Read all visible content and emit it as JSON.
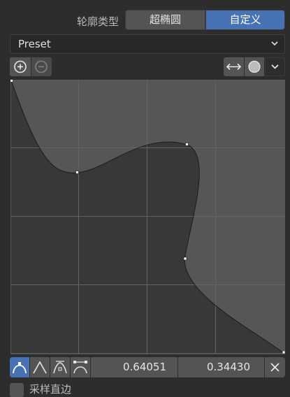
{
  "profile_type": {
    "label": "轮廓类型",
    "options": [
      "超椭圆",
      "自定义"
    ],
    "selected": "自定义"
  },
  "preset": {
    "label": "Preset"
  },
  "toolbar": {
    "zoom_in_icon": "zoom-in-icon",
    "zoom_out_icon": "zoom-out-icon",
    "flip_icon": "horizontal-arrows-icon",
    "reset_icon": "circle-dot-icon",
    "menu_icon": "chevron-down-icon"
  },
  "handles": {
    "selected_x": "0.64051",
    "selected_y": "0.34430"
  },
  "checkbox": {
    "label": "采样直边"
  },
  "colors": {
    "accent": "#4772b3",
    "background": "#2d2d2d",
    "widget": "#545454"
  }
}
